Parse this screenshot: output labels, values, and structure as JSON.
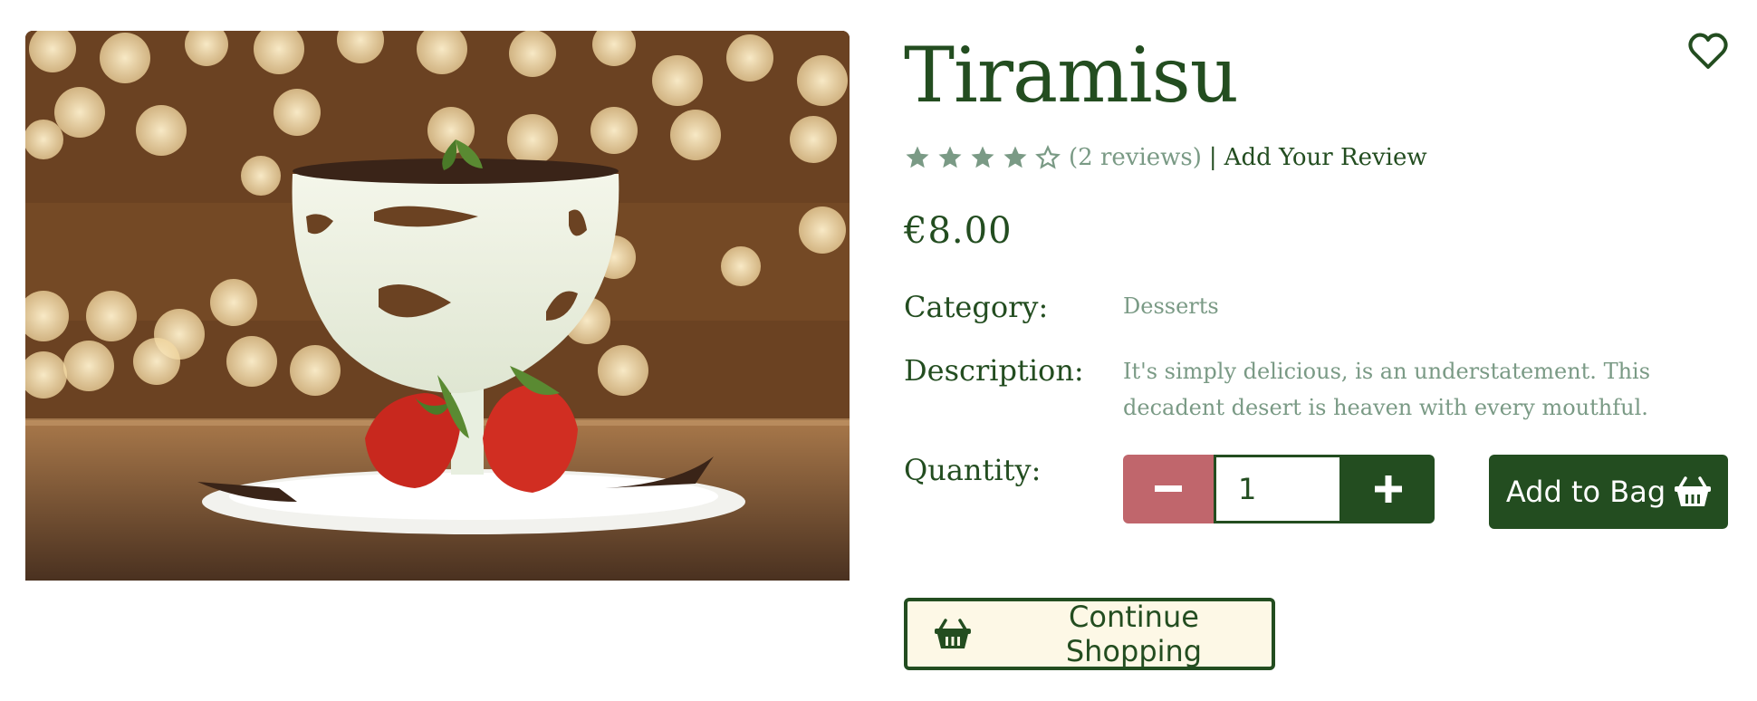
{
  "product": {
    "title": "Tiramisu",
    "rating": {
      "stars": 4,
      "max": 5,
      "reviews_text": "(2 reviews)",
      "separator": "|",
      "add_review": "Add Your Review"
    },
    "price": "€8.00",
    "category_label": "Category:",
    "category_value": "Desserts",
    "description_label": "Description:",
    "description_value": "It's simply delicious, is an understatement. This decadent desert is heaven with every mouthful.",
    "quantity_label": "Quantity:",
    "quantity_value": "1"
  },
  "actions": {
    "add_to_bag": "Add to Bag",
    "continue_shopping": "Continue Shopping"
  },
  "icons": {
    "wishlist": "heart-icon",
    "basket": "basket-icon",
    "minus": "minus-icon",
    "plus": "plus-icon"
  },
  "colors": {
    "primary": "#234d20",
    "muted": "#7a9a85",
    "danger": "#c0666c",
    "cream": "#fdf8e6"
  }
}
